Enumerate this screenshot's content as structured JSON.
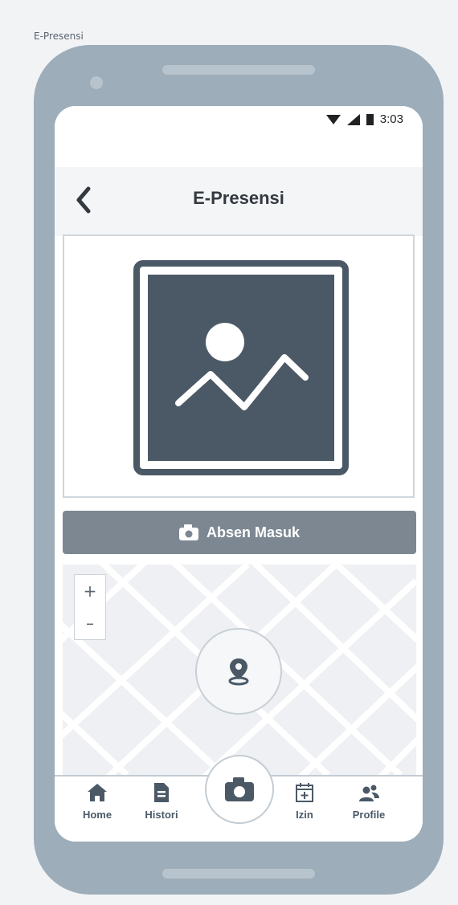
{
  "frame": {
    "label": "E-Presensi"
  },
  "status_bar": {
    "time": "3:03",
    "icons": [
      "wifi-icon",
      "signal-icon",
      "battery-icon"
    ]
  },
  "header": {
    "title": "E-Presensi",
    "back_icon": "chevron-left-icon"
  },
  "photo": {
    "icon": "image-placeholder-icon"
  },
  "absen_button": {
    "label": "Absen Masuk",
    "icon": "camera-icon"
  },
  "map": {
    "zoom_in": "+",
    "zoom_out": "–",
    "location_icon": "map-pin-icon"
  },
  "bottom_nav": {
    "items": [
      {
        "label": "Home",
        "icon": "home-icon"
      },
      {
        "label": "Histori",
        "icon": "document-icon"
      },
      {
        "label": "Izin",
        "icon": "calendar-plus-icon"
      },
      {
        "label": "Profile",
        "icon": "users-icon"
      }
    ],
    "center_icon": "camera-icon"
  },
  "colors": {
    "device": "#9dadb9",
    "dark": "#4b5967",
    "button": "#7c8792",
    "header_bg": "#f3f5f7"
  }
}
